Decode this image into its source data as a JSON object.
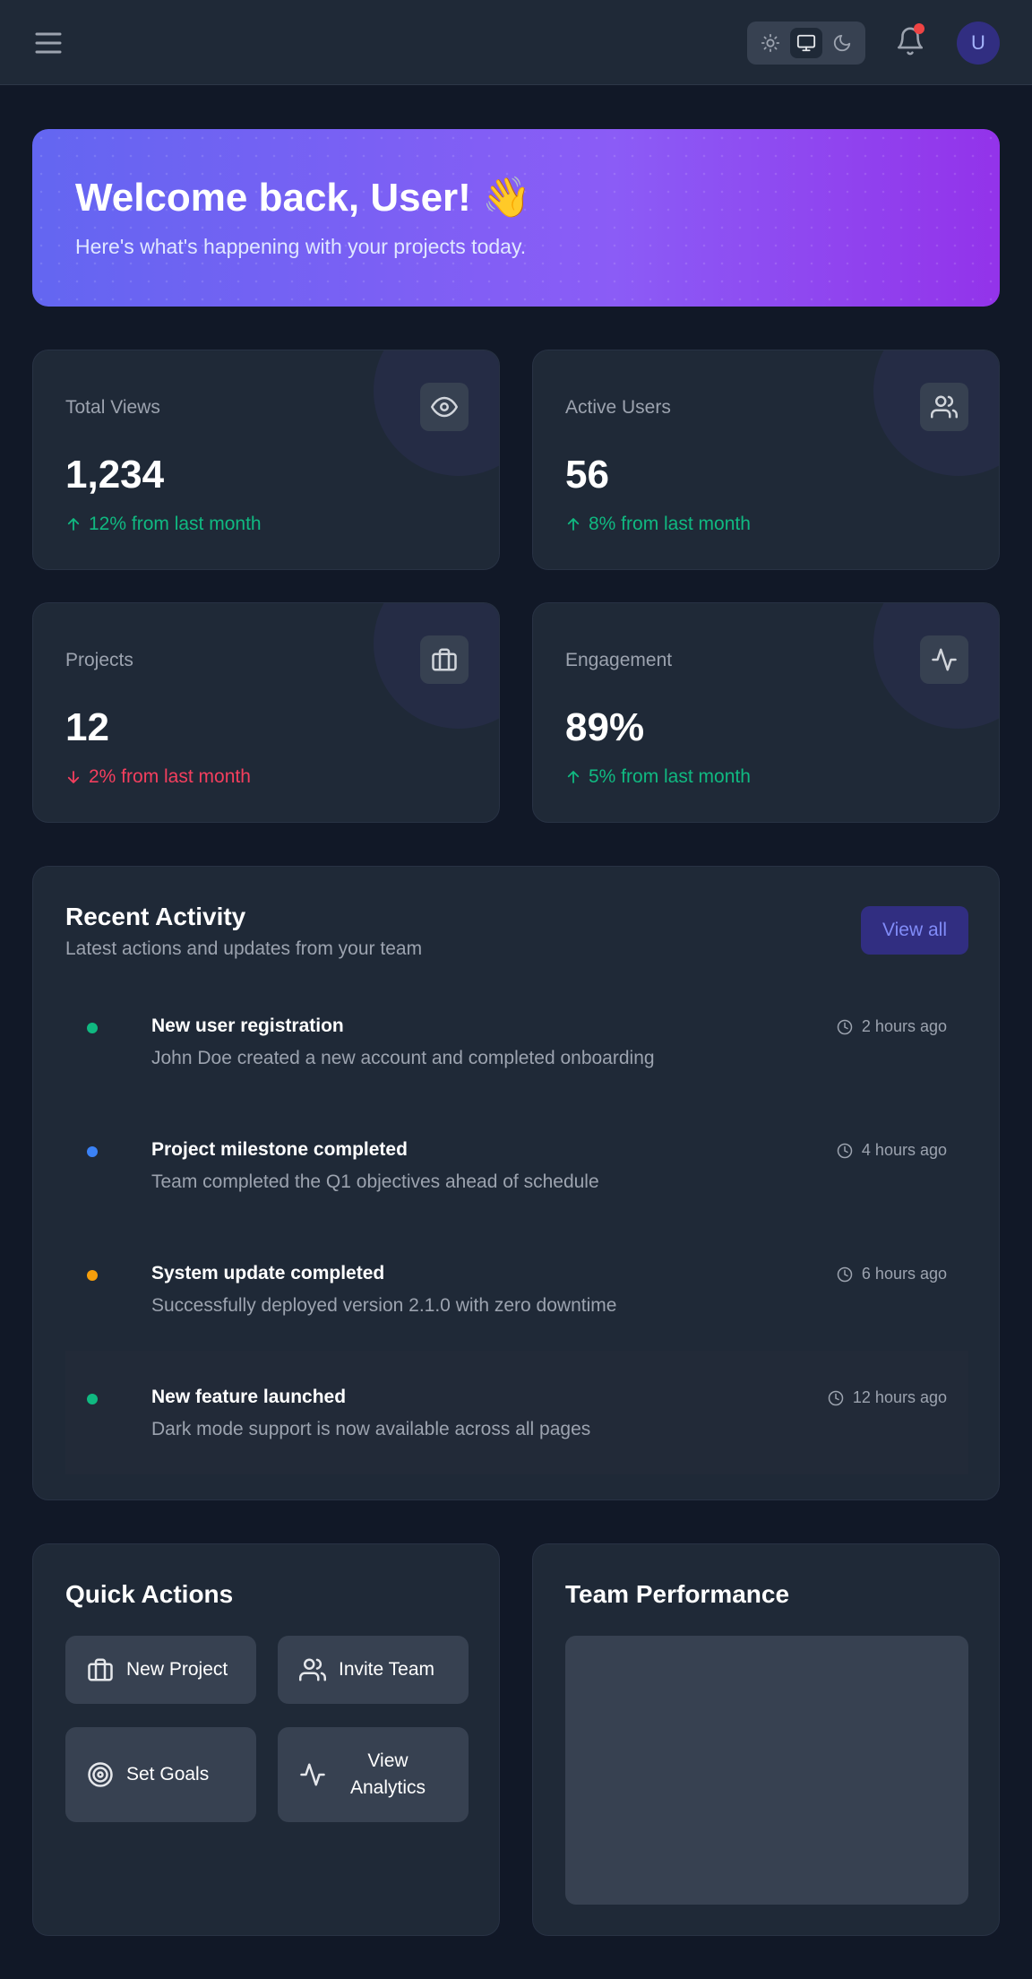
{
  "header": {
    "avatar_initial": "U",
    "theme_options": [
      "light",
      "system",
      "dark"
    ],
    "theme_selected": "system",
    "has_notification": true
  },
  "hero": {
    "title": "Welcome back, User! 👋",
    "subtitle": "Here's what's happening with your projects today."
  },
  "stats": [
    {
      "label": "Total Views",
      "value": "1,234",
      "change": "12% from last month",
      "trend": "up",
      "icon": "eye-icon"
    },
    {
      "label": "Active Users",
      "value": "56",
      "change": "8% from last month",
      "trend": "up",
      "icon": "users-icon"
    },
    {
      "label": "Projects",
      "value": "12",
      "change": "2% from last month",
      "trend": "down",
      "icon": "briefcase-icon"
    },
    {
      "label": "Engagement",
      "value": "89%",
      "change": "5% from last month",
      "trend": "up",
      "icon": "activity-icon"
    }
  ],
  "activity": {
    "title": "Recent Activity",
    "subtitle": "Latest actions and updates from your team",
    "view_all": "View all",
    "items": [
      {
        "title": "New user registration",
        "desc": "John Doe created a new account and completed onboarding",
        "time": "2 hours ago",
        "color": "#10b981"
      },
      {
        "title": "Project milestone completed",
        "desc": "Team completed the Q1 objectives ahead of schedule",
        "time": "4 hours ago",
        "color": "#3b82f6"
      },
      {
        "title": "System update completed",
        "desc": "Successfully deployed version 2.1.0 with zero downtime",
        "time": "6 hours ago",
        "color": "#f59e0b"
      },
      {
        "title": "New feature launched",
        "desc": "Dark mode support is now available across all pages",
        "time": "12 hours ago",
        "color": "#10b981"
      }
    ]
  },
  "quick_actions": {
    "title": "Quick Actions",
    "buttons": [
      "New Project",
      "Invite Team",
      "Set Goals",
      "View Analytics"
    ]
  },
  "team_performance": {
    "title": "Team Performance"
  },
  "colors": {
    "accent": "#6366f1",
    "up": "#10b981",
    "down": "#f43f5e"
  }
}
